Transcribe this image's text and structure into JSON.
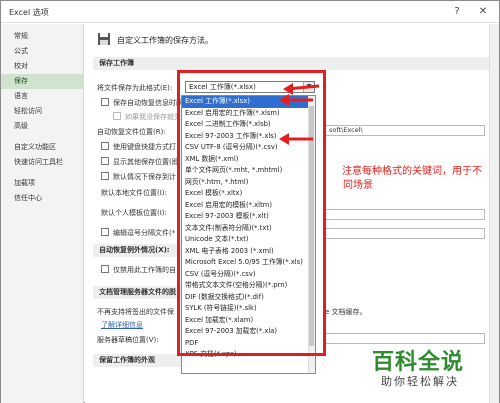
{
  "window": {
    "title": "Excel 选项",
    "help_glyph": "?",
    "close_glyph": "✕"
  },
  "sidebar": {
    "items": [
      {
        "label": "常规"
      },
      {
        "label": "公式"
      },
      {
        "label": "校对"
      },
      {
        "label": "保存"
      },
      {
        "label": "语言"
      },
      {
        "label": "轻松访问"
      },
      {
        "label": "高级"
      },
      {
        "label": "自定义功能区"
      },
      {
        "label": "快速访问工具栏"
      },
      {
        "label": "加载项"
      },
      {
        "label": "信任中心"
      }
    ]
  },
  "content": {
    "header": "自定义工作簿的保存方法。",
    "section_save": "保存工作簿",
    "format_label": "将文件保存为此格式(E):",
    "autorecover_label": "保存自动恢复信息时间",
    "no_autosave_label": "如果我没保存就关",
    "autorecover_location_label": "自动恢复文件位置(R):",
    "autorecover_path_tail": "soft\\Excel\\",
    "keyboard_label": "使用键盘快捷方式打",
    "show_more_label": "显示其他保存位置(即",
    "default_local_label": "默认情况下保存到计",
    "default_local_location_label": "默认本地文件位置(I):",
    "personal_template_label": "默认个人模板位置(I):",
    "edit_separated_label": "编辑逗号分隔文件(*",
    "section_autorecover_exceptions": "自动恢复例外情况(X):",
    "disable_autorecover_label": "仅禁用此工作簿的自",
    "section_offline": "文档管理服务器文件的脱",
    "offline_desc": "不再支持将签出的文件保",
    "offline_desc_tail": "e 文档缓存。",
    "more_info_link": "了解详细信息",
    "server_drafts_label": "服务器草稿位置(V):",
    "section_appearance": "保留工作簿的外观"
  },
  "format_combo": {
    "selected": "Excel 工作簿(*.xlsx)",
    "arrow": "▼"
  },
  "format_options": [
    {
      "label": "Excel 工作簿(*.xlsx)",
      "highlighted": true
    },
    {
      "label": "Excel 启用宏的工作簿(*.xlsm)"
    },
    {
      "label": "Excel 二进制工作簿(*.xlsb)"
    },
    {
      "label": "Excel 97-2003 工作簿(*.xls)"
    },
    {
      "label": "CSV UTF-8 (逗号分隔)(*.csv)"
    },
    {
      "label": "XML 数据(*.xml)"
    },
    {
      "label": "单个文件网页(*.mht, *.mhtml)"
    },
    {
      "label": "网页(*.htm, *.html)"
    },
    {
      "label": "Excel 模板(*.xltx)"
    },
    {
      "label": "Excel 启用宏的模板(*.xltm)"
    },
    {
      "label": "Excel 97-2003 模板(*.xlt)"
    },
    {
      "label": "文本文件(制表符分隔)(*.txt)"
    },
    {
      "label": "Unicode 文本(*.txt)"
    },
    {
      "label": "XML 电子表格 2003 (*.xml)"
    },
    {
      "label": "Microsoft Excel 5.0/95 工作簿(*.xls)"
    },
    {
      "label": "CSV (逗号分隔)(*.csv)"
    },
    {
      "label": "带格式文本文件(空格分隔)(*.prn)"
    },
    {
      "label": "DIF (数据交换格式)(*.dif)"
    },
    {
      "label": "SYLK (符号链接)(*.slk)"
    },
    {
      "label": "Excel 加载宏(*.xlam)"
    },
    {
      "label": "Excel 97-2003 加载宏(*.xla)"
    },
    {
      "label": "PDF"
    },
    {
      "label": "XPS 文档(*.xps)"
    }
  ],
  "annotation": {
    "line1": "注意每种格式的关键词，用于不",
    "line2": "同场景",
    "color": "#e02020"
  },
  "watermark": {
    "top": "百科全说",
    "bottom": "助你轻松解决"
  }
}
